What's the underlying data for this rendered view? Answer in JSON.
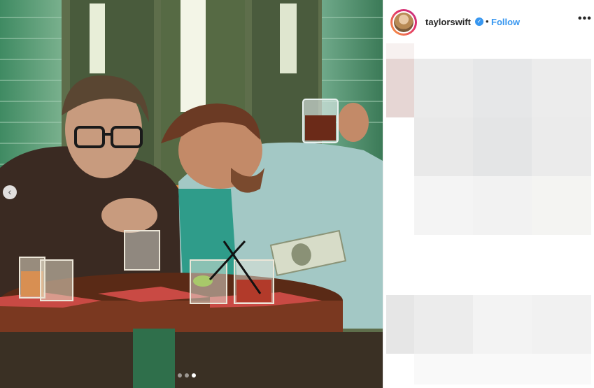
{
  "post": {
    "username": "taylorswift",
    "verified": true,
    "separator": "•",
    "follow_label": "Follow",
    "more_label": "•••"
  },
  "media": {
    "description": "photo",
    "carousel_total": 3,
    "carousel_active": 3
  },
  "colors": {
    "accent": "#3897f0",
    "text": "#262626"
  }
}
